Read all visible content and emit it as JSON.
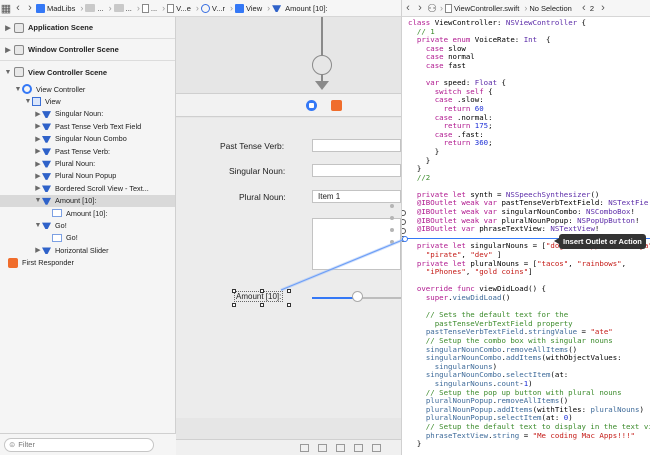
{
  "breadcrumb_left": [
    "MadLibs",
    "...",
    "...",
    "...",
    "V...e",
    "V...r",
    "View",
    "Amount [10]:"
  ],
  "breadcrumb_right": [
    "ViewController.swift",
    "No Selection"
  ],
  "page_counter": "2",
  "outline": {
    "scenes": [
      {
        "label": "Application Scene",
        "expanded": false
      },
      {
        "label": "Window Controller Scene",
        "expanded": false
      },
      {
        "label": "View Controller Scene",
        "expanded": true
      }
    ],
    "items": [
      {
        "label": "View Controller",
        "level": 1,
        "icon": "view-controller-icon",
        "tri": "▼"
      },
      {
        "label": "View",
        "level": 2,
        "icon": "view-icon",
        "tri": "▼"
      },
      {
        "label": "Singular Noun:",
        "level": 3,
        "icon": "object-icon",
        "tri": "▶"
      },
      {
        "label": "Past Tense Verb Text Field",
        "level": 3,
        "icon": "object-icon",
        "tri": "▶"
      },
      {
        "label": "Singular Noun Combo",
        "level": 3,
        "icon": "object-icon",
        "tri": "▶"
      },
      {
        "label": "Past Tense Verb:",
        "level": 3,
        "icon": "object-icon",
        "tri": "▶"
      },
      {
        "label": "Plural Noun:",
        "level": 3,
        "icon": "object-icon",
        "tri": "▶"
      },
      {
        "label": "Plural Noun Popup",
        "level": 3,
        "icon": "object-icon",
        "tri": "▶"
      },
      {
        "label": "Bordered Scroll View - Text...",
        "level": 3,
        "icon": "object-icon",
        "tri": "▶"
      },
      {
        "label": "Amount [10]:",
        "level": 3,
        "icon": "object-icon",
        "tri": "▼",
        "selected": true
      },
      {
        "label": "Amount [10]:",
        "level": 4,
        "icon": "cell-icon",
        "tri": ""
      },
      {
        "label": "Go!",
        "level": 3,
        "icon": "object-icon",
        "tri": "▼"
      },
      {
        "label": "Go!",
        "level": 4,
        "icon": "cell-icon",
        "tri": ""
      },
      {
        "label": "Horizontal Slider",
        "level": 3,
        "icon": "object-icon",
        "tri": "▶"
      }
    ],
    "first_responder": "First Responder",
    "filter_placeholder": "Filter"
  },
  "canvas": {
    "past_tense_label": "Past Tense Verb:",
    "singular_noun_label": "Singular Noun:",
    "plural_noun_label": "Plural Noun:",
    "popup_value": "Item 1",
    "amount_label": "Amount [10]:"
  },
  "code": {
    "lines": [
      [
        {
          "t": "class ",
          "c": "kw"
        },
        {
          "t": "ViewController: "
        },
        {
          "t": "NSViewController",
          "c": "ty"
        },
        {
          "t": " {"
        }
      ],
      [
        {
          "t": "  // 1",
          "c": "cm"
        }
      ],
      [
        {
          "t": "  "
        },
        {
          "t": "private enum ",
          "c": "kw"
        },
        {
          "t": "VoiceRate: "
        },
        {
          "t": "Int",
          "c": "ty"
        },
        {
          "t": "  {"
        }
      ],
      [
        {
          "t": "    "
        },
        {
          "t": "case ",
          "c": "kw"
        },
        {
          "t": "slow"
        }
      ],
      [
        {
          "t": "    "
        },
        {
          "t": "case ",
          "c": "kw"
        },
        {
          "t": "normal"
        }
      ],
      [
        {
          "t": "    "
        },
        {
          "t": "case ",
          "c": "kw"
        },
        {
          "t": "fast"
        }
      ],
      [
        {
          "t": ""
        }
      ],
      [
        {
          "t": "    "
        },
        {
          "t": "var ",
          "c": "kw"
        },
        {
          "t": "speed: "
        },
        {
          "t": "Float",
          "c": "ty"
        },
        {
          "t": " {"
        }
      ],
      [
        {
          "t": "      "
        },
        {
          "t": "switch self ",
          "c": "kw"
        },
        {
          "t": "{"
        }
      ],
      [
        {
          "t": "      "
        },
        {
          "t": "case ",
          "c": "kw"
        },
        {
          "t": ".slow:"
        }
      ],
      [
        {
          "t": "        "
        },
        {
          "t": "return ",
          "c": "kw"
        },
        {
          "t": "60",
          "c": "nm"
        }
      ],
      [
        {
          "t": "      "
        },
        {
          "t": "case ",
          "c": "kw"
        },
        {
          "t": ".normal:"
        }
      ],
      [
        {
          "t": "        "
        },
        {
          "t": "return ",
          "c": "kw"
        },
        {
          "t": "175",
          "c": "nm"
        },
        {
          "t": ";"
        }
      ],
      [
        {
          "t": "      "
        },
        {
          "t": "case ",
          "c": "kw"
        },
        {
          "t": ".fast:"
        }
      ],
      [
        {
          "t": "        "
        },
        {
          "t": "return ",
          "c": "kw"
        },
        {
          "t": "360",
          "c": "nm"
        },
        {
          "t": ";"
        }
      ],
      [
        {
          "t": "      }"
        }
      ],
      [
        {
          "t": "    }"
        }
      ],
      [
        {
          "t": "  }"
        }
      ],
      [
        {
          "t": "  //2",
          "c": "cm"
        }
      ],
      [
        {
          "t": ""
        }
      ],
      [
        {
          "t": "  "
        },
        {
          "t": "private let ",
          "c": "kw"
        },
        {
          "t": "synth = "
        },
        {
          "t": "NSSpeechSynthesizer",
          "c": "ty"
        },
        {
          "t": "()"
        }
      ],
      [
        {
          "t": "  "
        },
        {
          "t": "@IBOutlet weak var ",
          "c": "kw"
        },
        {
          "t": "pastTenseVerbTextField: "
        },
        {
          "t": "NSTextFie",
          "c": "ty"
        }
      ],
      [
        {
          "t": "  "
        },
        {
          "t": "@IBOutlet weak var ",
          "c": "kw"
        },
        {
          "t": "singularNounCombo: "
        },
        {
          "t": "NSComboBox",
          "c": "ty"
        },
        {
          "t": "!"
        }
      ],
      [
        {
          "t": "  "
        },
        {
          "t": "@IBOutlet weak var ",
          "c": "kw"
        },
        {
          "t": "pluralNounPopup: "
        },
        {
          "t": "NSPopUpButton",
          "c": "ty"
        },
        {
          "t": "!"
        }
      ],
      [
        {
          "t": "  "
        },
        {
          "t": "@IBOutlet var ",
          "c": "kw"
        },
        {
          "t": "phraseTextView: "
        },
        {
          "t": "NSTextView",
          "c": "ty"
        },
        {
          "t": "!"
        }
      ],
      [
        {
          "t": ""
        }
      ],
      [
        {
          "t": "  "
        },
        {
          "t": "private let ",
          "c": "kw"
        },
        {
          "t": "singularNouns = ["
        },
        {
          "t": "\"dog\"",
          "c": "st"
        },
        {
          "t": ", "
        },
        {
          "t": "\"muppet\"",
          "c": "st"
        },
        {
          "t": ", "
        },
        {
          "t": "\"ninja\"",
          "c": "st"
        }
      ],
      [
        {
          "t": "    "
        },
        {
          "t": "\"pirate\"",
          "c": "st"
        },
        {
          "t": ", "
        },
        {
          "t": "\"dev\"",
          "c": "st"
        },
        {
          "t": " ]"
        }
      ],
      [
        {
          "t": "  "
        },
        {
          "t": "private let ",
          "c": "kw"
        },
        {
          "t": "pluralNouns = ["
        },
        {
          "t": "\"tacos\"",
          "c": "st"
        },
        {
          "t": ", "
        },
        {
          "t": "\"rainbows\"",
          "c": "st"
        },
        {
          "t": ","
        }
      ],
      [
        {
          "t": "    "
        },
        {
          "t": "\"iPhones\"",
          "c": "st"
        },
        {
          "t": ", "
        },
        {
          "t": "\"gold coins\"",
          "c": "st"
        },
        {
          "t": "]"
        }
      ],
      [
        {
          "t": ""
        }
      ],
      [
        {
          "t": "  "
        },
        {
          "t": "override func ",
          "c": "kw"
        },
        {
          "t": "viewDidLoad() {"
        }
      ],
      [
        {
          "t": "    "
        },
        {
          "t": "super",
          "c": "kw"
        },
        {
          "t": "."
        },
        {
          "t": "viewDidLoad",
          "c": "fn"
        },
        {
          "t": "()"
        }
      ],
      [
        {
          "t": ""
        }
      ],
      [
        {
          "t": "    // Sets the default text for the",
          "c": "cm"
        }
      ],
      [
        {
          "t": "      pastTenseVerbTextField property",
          "c": "cm"
        }
      ],
      [
        {
          "t": "    "
        },
        {
          "t": "pastTenseVerbTextField",
          "c": "fn"
        },
        {
          "t": "."
        },
        {
          "t": "stringValue",
          "c": "fn"
        },
        {
          "t": " = "
        },
        {
          "t": "\"ate\"",
          "c": "st"
        }
      ],
      [
        {
          "t": "    // Setup the combo box with singular nouns",
          "c": "cm"
        }
      ],
      [
        {
          "t": "    "
        },
        {
          "t": "singularNounCombo",
          "c": "fn"
        },
        {
          "t": "."
        },
        {
          "t": "removeAllItems",
          "c": "fn"
        },
        {
          "t": "()"
        }
      ],
      [
        {
          "t": "    "
        },
        {
          "t": "singularNounCombo",
          "c": "fn"
        },
        {
          "t": "."
        },
        {
          "t": "addItems",
          "c": "fn"
        },
        {
          "t": "(withObjectValues:"
        }
      ],
      [
        {
          "t": "      "
        },
        {
          "t": "singularNouns",
          "c": "fn"
        },
        {
          "t": ")"
        }
      ],
      [
        {
          "t": "    "
        },
        {
          "t": "singularNounCombo",
          "c": "fn"
        },
        {
          "t": "."
        },
        {
          "t": "selectItem",
          "c": "fn"
        },
        {
          "t": "(at:"
        }
      ],
      [
        {
          "t": "      "
        },
        {
          "t": "singularNouns",
          "c": "fn"
        },
        {
          "t": "."
        },
        {
          "t": "count",
          "c": "fn"
        },
        {
          "t": "-"
        },
        {
          "t": "1",
          "c": "nm"
        },
        {
          "t": ")"
        }
      ],
      [
        {
          "t": "    // Setup the pop up button with plural nouns",
          "c": "cm"
        }
      ],
      [
        {
          "t": "    "
        },
        {
          "t": "pluralNounPopup",
          "c": "fn"
        },
        {
          "t": "."
        },
        {
          "t": "removeAllItems",
          "c": "fn"
        },
        {
          "t": "()"
        }
      ],
      [
        {
          "t": "    "
        },
        {
          "t": "pluralNounPopup",
          "c": "fn"
        },
        {
          "t": "."
        },
        {
          "t": "addItems",
          "c": "fn"
        },
        {
          "t": "(withTitles: "
        },
        {
          "t": "pluralNouns",
          "c": "fn"
        },
        {
          "t": ")"
        }
      ],
      [
        {
          "t": "    "
        },
        {
          "t": "pluralNounPopup",
          "c": "fn"
        },
        {
          "t": "."
        },
        {
          "t": "selectItem",
          "c": "fn"
        },
        {
          "t": "(at: "
        },
        {
          "t": "0",
          "c": "nm"
        },
        {
          "t": ")"
        }
      ],
      [
        {
          "t": "    // Setup the default text to display in the text view",
          "c": "cm"
        }
      ],
      [
        {
          "t": "    "
        },
        {
          "t": "phraseTextView",
          "c": "fn"
        },
        {
          "t": "."
        },
        {
          "t": "string",
          "c": "fn"
        },
        {
          "t": " = "
        },
        {
          "t": "\"Me coding Mac Apps!!!\"",
          "c": "st"
        }
      ],
      [
        {
          "t": "  }"
        }
      ]
    ]
  },
  "tooltip": "Insert Outlet or Action",
  "colors": {
    "accent": "#3478f6",
    "keyword": "#b0198f",
    "type": "#5b2ba8",
    "comment": "#3a8a2a",
    "string": "#c41a16"
  }
}
